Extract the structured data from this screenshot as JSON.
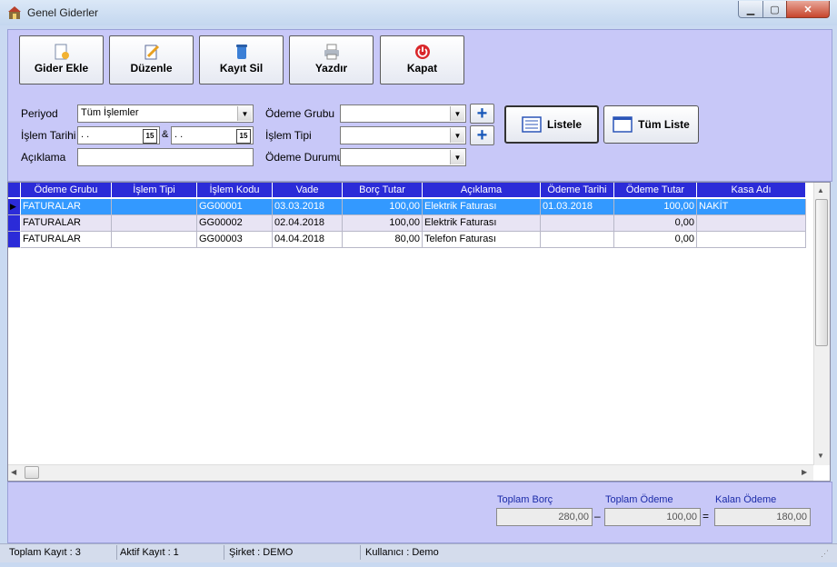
{
  "window": {
    "title": "Genel Giderler",
    "min_label": "▁",
    "max_label": "▢",
    "close_label": "✕"
  },
  "toolbar": {
    "add": "Gider Ekle",
    "edit": "Düzenle",
    "delete": "Kayıt Sil",
    "print": "Yazdır",
    "close": "Kapat"
  },
  "form": {
    "periyod_label": "Periyod",
    "periyod_value": "Tüm İşlemler",
    "islem_tarihi_label": "İşlem Tarihi",
    "date_from": " . .",
    "date_sep": "&",
    "date_to": " . .",
    "aciklama_label": "Açıklama",
    "aciklama_value": "",
    "odeme_grubu_label": "Ödeme Grubu",
    "odeme_grubu_value": "",
    "islem_tipi_label": "İşlem Tipi",
    "islem_tipi_value": "",
    "odeme_durumu_label": "Ödeme Durumu",
    "odeme_durumu_value": "",
    "calendar_glyph": "15",
    "plus_glyph": "+",
    "listele": "Listele",
    "tum_liste": "Tüm Liste"
  },
  "grid": {
    "columns": [
      "Ödeme Grubu",
      "İşlem Tipi",
      "İşlem Kodu",
      "Vade",
      "Borç Tutar",
      "Açıklama",
      "Ödeme Tarihi",
      "Ödeme Tutar",
      "Kasa Adı"
    ],
    "rows": [
      {
        "grup": "FATURALAR",
        "tip": "",
        "kod": "GG00001",
        "vade": "03.03.2018",
        "borc": "100,00",
        "aciklama": "Elektrik Faturası",
        "odeme_tarihi": "01.03.2018",
        "odeme_tutar": "100,00",
        "kasa": "NAKİT"
      },
      {
        "grup": "FATURALAR",
        "tip": "",
        "kod": "GG00002",
        "vade": "02.04.2018",
        "borc": "100,00",
        "aciklama": "Elektrik Faturası",
        "odeme_tarihi": "",
        "odeme_tutar": "0,00",
        "kasa": ""
      },
      {
        "grup": "FATURALAR",
        "tip": "",
        "kod": "GG00003",
        "vade": "04.04.2018",
        "borc": "80,00",
        "aciklama": "Telefon Faturası",
        "odeme_tarihi": "",
        "odeme_tutar": "0,00",
        "kasa": ""
      }
    ]
  },
  "totals": {
    "borc_label": "Toplam Borç",
    "borc_value": "280,00",
    "minus": "–",
    "odeme_label": "Toplam Ödeme",
    "odeme_value": "100,00",
    "equals": "=",
    "kalan_label": "Kalan Ödeme",
    "kalan_value": "180,00"
  },
  "status": {
    "toplam_kayit": "Toplam Kayıt : 3",
    "aktif_kayit": "Aktif Kayıt : 1",
    "sirket": "Şirket : DEMO",
    "kullanici": "Kullanıcı : Demo"
  },
  "colors": {
    "header_blue": "#2b2bd8",
    "panel_lavender": "#c8c8f8",
    "selection": "#3399ff"
  }
}
